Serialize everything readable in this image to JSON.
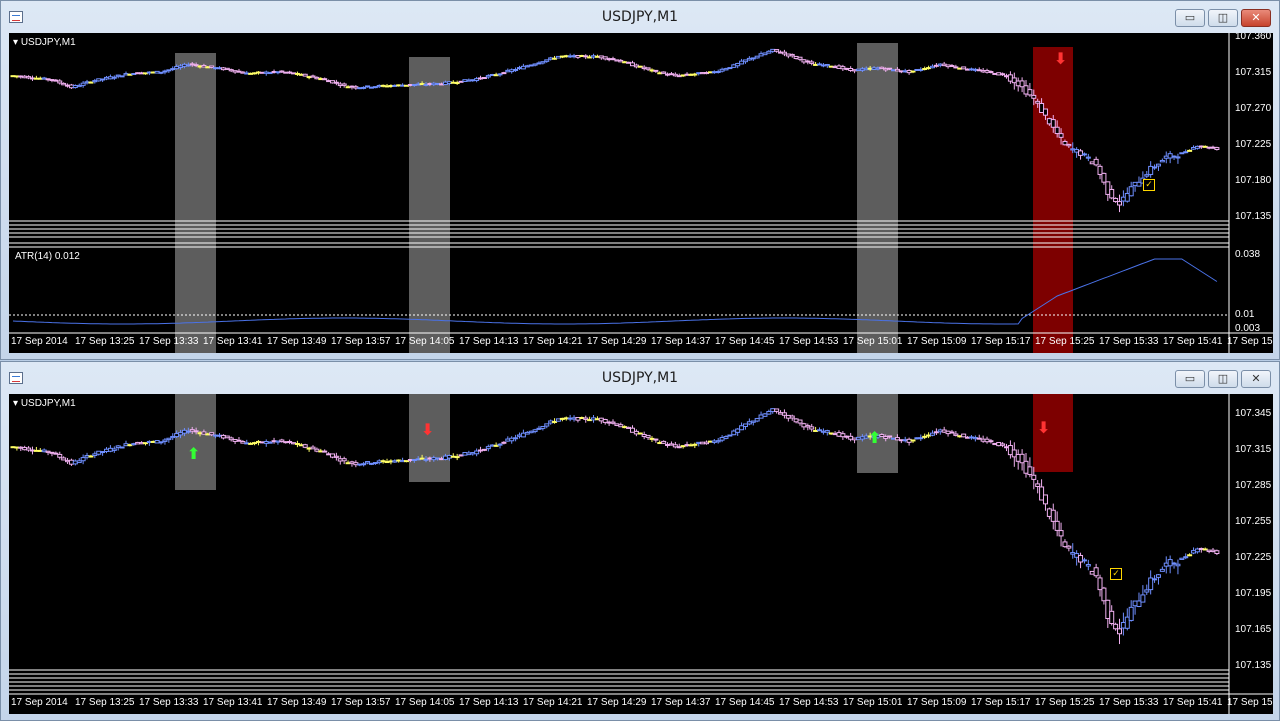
{
  "windows": [
    {
      "title": "USDJPY,M1",
      "symbol_label": "USDJPY,M1",
      "indicator_label": "ATR(14) 0.012",
      "price_labels": [
        "107.360",
        "107.315",
        "107.270",
        "107.225",
        "107.180",
        "107.135"
      ],
      "atr_labels": [
        "0.038",
        "0.01",
        "0.003"
      ],
      "time_labels": [
        "17 Sep 2014",
        "17 Sep 13:25",
        "17 Sep 13:33",
        "17 Sep 13:41",
        "17 Sep 13:49",
        "17 Sep 13:57",
        "17 Sep 14:05",
        "17 Sep 14:13",
        "17 Sep 14:21",
        "17 Sep 14:29",
        "17 Sep 14:37",
        "17 Sep 14:45",
        "17 Sep 14:53",
        "17 Sep 15:01",
        "17 Sep 15:09",
        "17 Sep 15:17",
        "17 Sep 15:25",
        "17 Sep 15:33",
        "17 Sep 15:41",
        "17 Sep 15:"
      ],
      "buttons": {
        "minimize": "▭",
        "maximize": "◫",
        "close": "✕"
      }
    },
    {
      "title": "USDJPY,M1",
      "symbol_label": "USDJPY,M1",
      "price_labels": [
        "107.345",
        "107.315",
        "107.285",
        "107.255",
        "107.225",
        "107.195",
        "107.165",
        "107.135"
      ],
      "time_labels": [
        "17 Sep 2014",
        "17 Sep 13:25",
        "17 Sep 13:33",
        "17 Sep 13:41",
        "17 Sep 13:49",
        "17 Sep 13:57",
        "17 Sep 14:05",
        "17 Sep 14:13",
        "17 Sep 14:21",
        "17 Sep 14:29",
        "17 Sep 14:37",
        "17 Sep 14:45",
        "17 Sep 14:53",
        "17 Sep 15:01",
        "17 Sep 15:09",
        "17 Sep 15:17",
        "17 Sep 15:25",
        "17 Sep 15:33",
        "17 Sep 15:41",
        "17 Sep 15:"
      ],
      "buttons": {
        "minimize": "▭",
        "maximize": "◫",
        "close": "✕"
      }
    }
  ],
  "colors": {
    "background": "#000000",
    "bull": "#6f8fff",
    "bear": "#f0b0f0",
    "doji": "#ffff66",
    "atr_line": "#4a72e8",
    "highlight_gray": "#aaaaaa",
    "highlight_red": "#c00000",
    "arrow_up": "#33ff33",
    "arrow_down": "#ff3333",
    "check": "#ffd700"
  },
  "icons": {
    "arrow_up": "up-arrow-icon",
    "arrow_down": "down-arrow-icon",
    "check": "check-box-icon",
    "menu": "triangle-down-icon"
  }
}
